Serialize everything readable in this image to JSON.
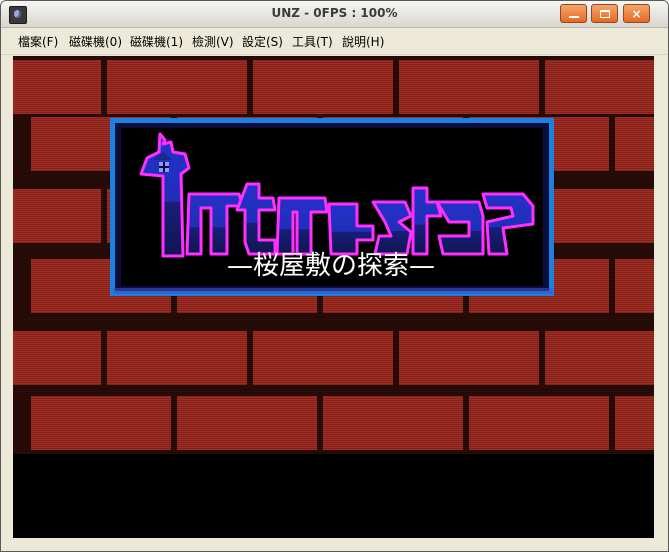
{
  "window": {
    "title": "UNZ - 0FPS : 100%",
    "icon": "app-icon",
    "controls": {
      "minimize": "minimize-icon",
      "maximize": "maximize-icon",
      "close_glyph": "×"
    }
  },
  "menu": {
    "items": [
      {
        "label": "檔案(F)"
      },
      {
        "label": "磁碟機(0)"
      },
      {
        "label": "磁碟機(1)"
      },
      {
        "label": "檢測(V)"
      },
      {
        "label": "設定(S)"
      },
      {
        "label": "工具(T)"
      },
      {
        "label": "說明(H)"
      }
    ]
  },
  "game": {
    "logo_text": "Intruder",
    "subtitle": "—桜屋敷の探索—",
    "colors": {
      "brick": "#a32d22",
      "mortar": "#2a0c08",
      "frame": "#1d7fe0",
      "logo_fill": "#1a2fb8",
      "logo_outline": "#ff30ff"
    }
  }
}
